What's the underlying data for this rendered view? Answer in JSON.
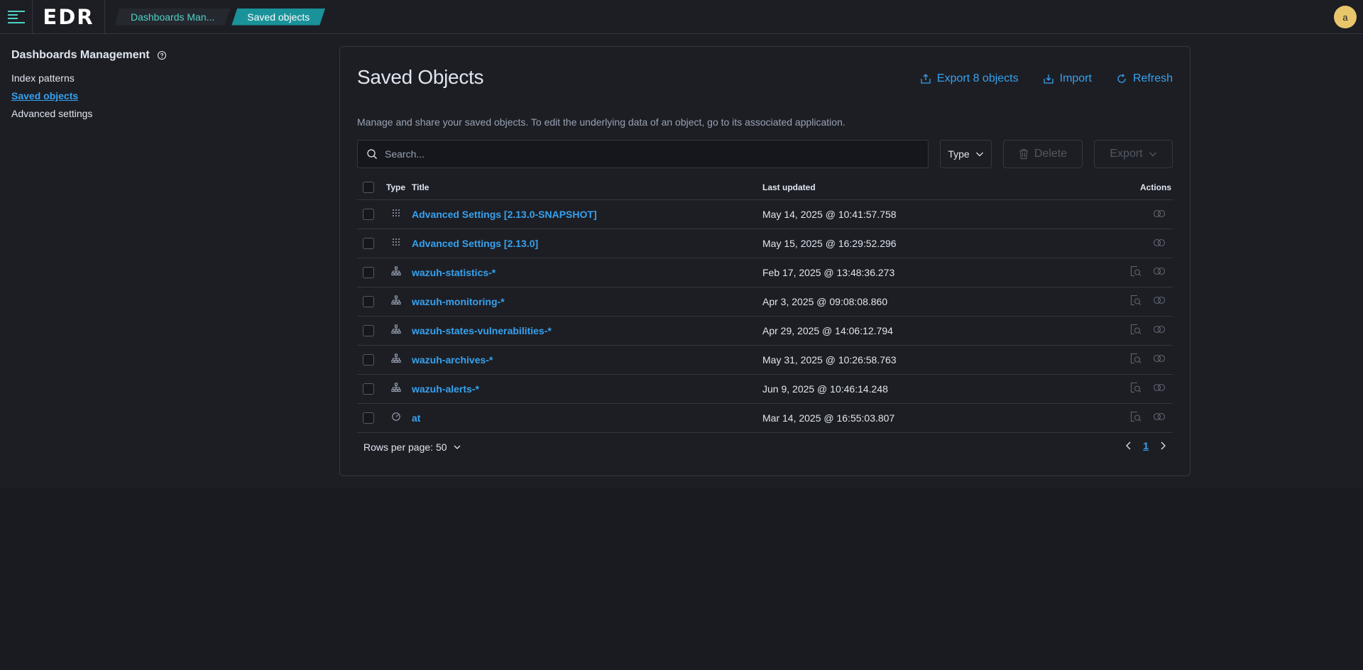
{
  "header": {
    "logo": "EDR",
    "breadcrumbs": [
      "Dashboards Man...",
      "Saved objects"
    ],
    "avatar": "a"
  },
  "sidebar": {
    "title": "Dashboards Management",
    "items": [
      {
        "label": "Index patterns",
        "active": false
      },
      {
        "label": "Saved objects",
        "active": true
      },
      {
        "label": "Advanced settings",
        "active": false
      }
    ]
  },
  "main": {
    "title": "Saved Objects",
    "description": "Manage and share your saved objects. To edit the underlying data of an object, go to its associated application.",
    "actions": {
      "export_all": "Export 8 objects",
      "import": "Import",
      "refresh": "Refresh"
    },
    "search": {
      "placeholder": "Search..."
    },
    "type_filter": "Type",
    "delete_label": "Delete",
    "export_label": "Export",
    "columns": {
      "type": "Type",
      "title": "Title",
      "updated": "Last updated",
      "actions": "Actions"
    },
    "rows": [
      {
        "icon": "config-icon",
        "title": "Advanced Settings [2.13.0-SNAPSHOT]",
        "updated": "May 14, 2025 @ 10:41:57.758",
        "inspect": false
      },
      {
        "icon": "config-icon",
        "title": "Advanced Settings [2.13.0]",
        "updated": "May 15, 2025 @ 16:29:52.296",
        "inspect": false
      },
      {
        "icon": "index-pattern-icon",
        "title": "wazuh-statistics-*",
        "updated": "Feb 17, 2025 @ 13:48:36.273",
        "inspect": true
      },
      {
        "icon": "index-pattern-icon",
        "title": "wazuh-monitoring-*",
        "updated": "Apr 3, 2025 @ 09:08:08.860",
        "inspect": true
      },
      {
        "icon": "index-pattern-icon",
        "title": "wazuh-states-vulnerabilities-*",
        "updated": "Apr 29, 2025 @ 14:06:12.794",
        "inspect": true
      },
      {
        "icon": "index-pattern-icon",
        "title": "wazuh-archives-*",
        "updated": "May 31, 2025 @ 10:26:58.763",
        "inspect": true
      },
      {
        "icon": "index-pattern-icon",
        "title": "wazuh-alerts-*",
        "updated": "Jun 9, 2025 @ 10:46:14.248",
        "inspect": true
      },
      {
        "icon": "dashboard-icon",
        "title": "at",
        "updated": "Mar 14, 2025 @ 16:55:03.807",
        "inspect": true
      }
    ],
    "rows_per_page": "Rows per page: 50",
    "current_page": "1"
  },
  "colors": {
    "accent": "#36a2ef",
    "teal": "#1a929a",
    "background": "#1d1e24",
    "border": "#343741",
    "avatar": "#e8c66b"
  }
}
